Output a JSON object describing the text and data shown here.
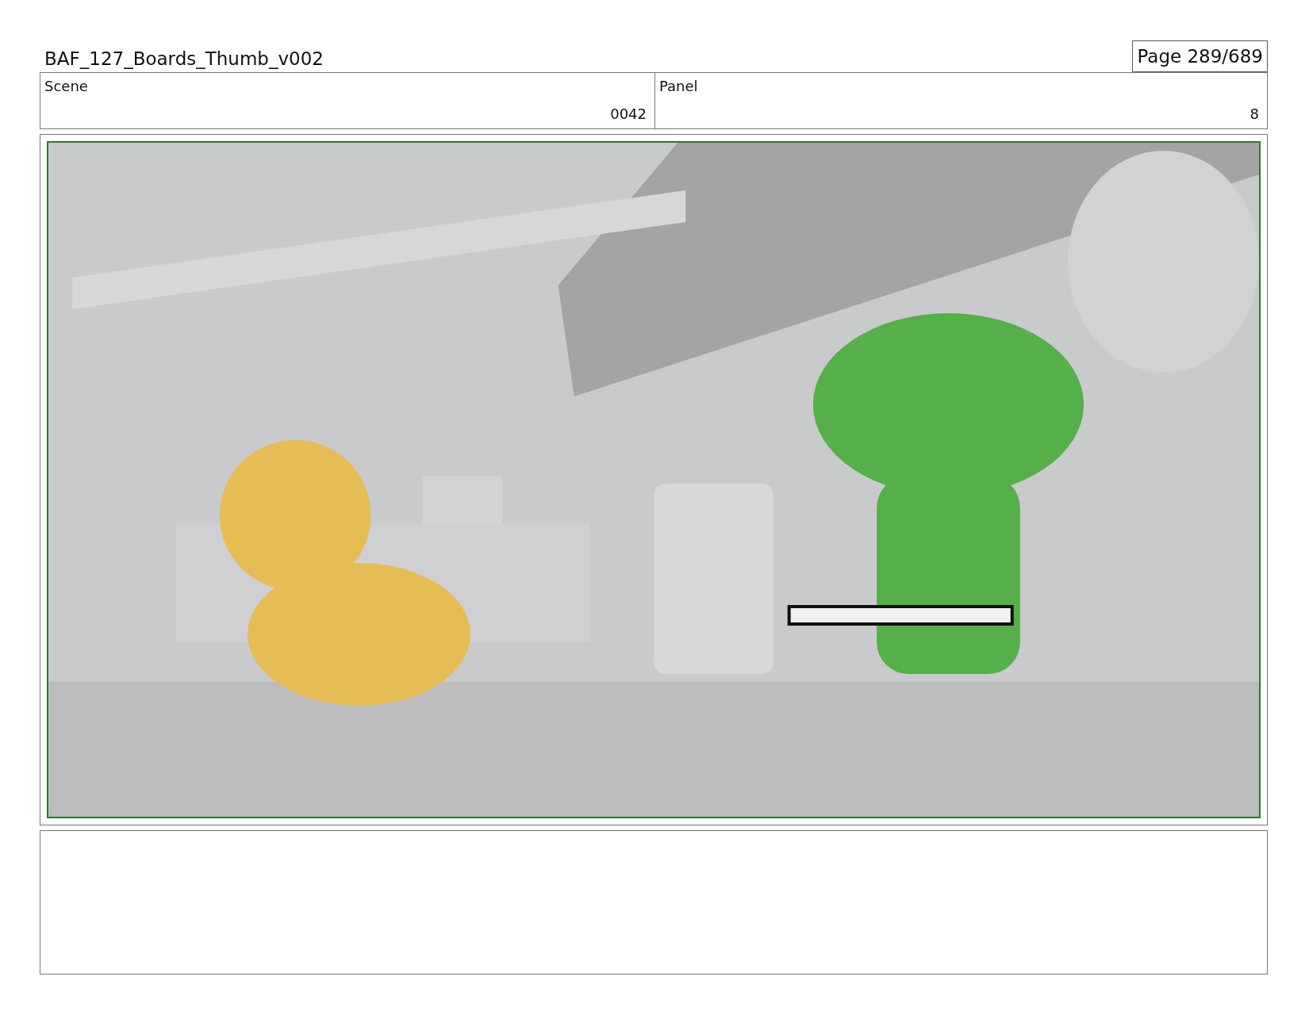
{
  "document": {
    "title": "BAF_127_Boards_Thumb_v002",
    "page": "Page 289/689"
  },
  "header": [
    {
      "label": "Scene",
      "value": "0042"
    },
    {
      "label": "Panel",
      "value": "8"
    }
  ]
}
